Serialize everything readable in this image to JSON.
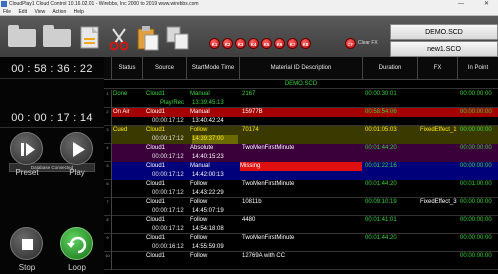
{
  "window": {
    "title": "CloudPlay1 Cloud Control 10.16.02.01 - Wirebbs, Inc 2000 to 2019  www.wirebbs.com",
    "minimize": "—",
    "close": "✕"
  },
  "menu": [
    "File",
    "Edit",
    "View",
    "Action",
    "Help"
  ],
  "toolbar": {
    "icons": [
      "folder-open-icon",
      "folder-icon",
      "save-icon",
      "cut-icon",
      "paste-icon",
      "copy-icon"
    ],
    "keyers": [
      "K1",
      "K2",
      "K3",
      "K4",
      "K5",
      "K6",
      "K7",
      "K8"
    ],
    "clear_fx_button": "CF",
    "clear_fx_label": "Clear FX",
    "scd_primary": "DEMO.SCD",
    "scd_secondary": "new1.SCO"
  },
  "left_panel": {
    "clock": "00 : 58 : 36 : 22",
    "countdown": "00 : 00 : 17 : 14",
    "db_status": "Database Connected",
    "preset_label": "Preset",
    "play_label": "Play",
    "stop_label": "Stop",
    "loop_label": "Loop"
  },
  "grid": {
    "headers": {
      "status": "Status",
      "source": "Source",
      "startmode": "StartMode Time",
      "material": "Material ID Description",
      "duration": "Duration",
      "fx": "FX",
      "inpoint": "In Point"
    },
    "group_title": "DEMO.SCD",
    "rows": [
      {
        "idx": "1",
        "status": "Done",
        "source": "Cloud1",
        "mode": "Manual",
        "material": "2167",
        "duration": "00:00:30:01",
        "fx": "",
        "inpoint": "00:00:00:00",
        "time_col": "",
        "time2": "13:39:45:13",
        "play_rec": "Play/Rec",
        "mat_bg": "",
        "style": "done"
      },
      {
        "idx": "2",
        "status": "On Air",
        "source": "Cloud1",
        "mode": "Manual",
        "material": "15977B",
        "duration": "00:58:54:06",
        "fx": "",
        "inpoint": "00:00:00:00",
        "time_col": "00:00:17:12",
        "time2": "13:40:42:24",
        "play_rec": "",
        "mat_bg": "",
        "style": "onair"
      },
      {
        "idx": "3",
        "status": "Cued",
        "source": "Cloud1",
        "mode": "Follow",
        "material": "70174",
        "duration": "00:01:05:03",
        "fx": "FixedEffect_1",
        "inpoint": "00:00:00:00",
        "time_col": "00:00:17:12",
        "time2": "14:39:37:00",
        "play_rec": "",
        "mat_bg": "",
        "style": "cued"
      },
      {
        "idx": "4",
        "status": "",
        "source": "Cloud1",
        "mode": "Absolute",
        "material": "TwoMenFirstMinute",
        "duration": "00:01:44:20",
        "fx": "",
        "inpoint": "00:00:00:00",
        "time_col": "00:00:17:12",
        "time2": "14:40:15:23",
        "play_rec": "",
        "mat_bg": "",
        "style": "purple"
      },
      {
        "idx": "5",
        "status": "",
        "source": "Cloud1",
        "mode": "Manual",
        "material": "Missing",
        "duration": "00:01:22:16",
        "fx": "",
        "inpoint": "00:00:00:00",
        "time_col": "00:00:17:12",
        "time2": "14:42:00:13",
        "play_rec": "",
        "mat_bg": "red",
        "style": "missing"
      },
      {
        "idx": "6",
        "status": "",
        "source": "Cloud1",
        "mode": "Follow",
        "material": "TwoMenFirstMinute",
        "duration": "00:01:44:20",
        "fx": "",
        "inpoint": "00:01:00:00",
        "time_col": "00:00:17:12",
        "time2": "14:43:22:29",
        "play_rec": "",
        "mat_bg": "",
        "style": "normal"
      },
      {
        "idx": "7",
        "status": "",
        "source": "Cloud1",
        "mode": "Follow",
        "material": "10811b",
        "duration": "00:09:10:19",
        "fx": "FixedEffect_3",
        "inpoint": "00:00:00:00",
        "time_col": "00:00:17:12",
        "time2": "14:45:07:19",
        "play_rec": "",
        "mat_bg": "",
        "style": "normal"
      },
      {
        "idx": "8",
        "status": "",
        "source": "Cloud1",
        "mode": "Follow",
        "material": "4480",
        "duration": "00:01:41:01",
        "fx": "",
        "inpoint": "00:00:00:00",
        "time_col": "00:00:17:12",
        "time2": "14:54:18:08",
        "play_rec": "",
        "mat_bg": "",
        "style": "normal"
      },
      {
        "idx": "9",
        "status": "",
        "source": "Cloud1",
        "mode": "Follow",
        "material": "TwoMenFirstMinute",
        "duration": "00:01:44:20",
        "fx": "",
        "inpoint": "00:00:00:00",
        "time_col": "00:00:16:12",
        "time2": "14:55:59:09",
        "play_rec": "",
        "mat_bg": "",
        "style": "normal"
      },
      {
        "idx": "10",
        "status": "",
        "source": "Cloud1",
        "mode": "Follow",
        "material": "12769A with CC",
        "duration": "",
        "fx": "",
        "inpoint": "00:00:00:00",
        "time_col": "",
        "time2": "",
        "play_rec": "",
        "mat_bg": "",
        "style": "normal"
      }
    ]
  },
  "colors": {
    "done_text": "#3ed43e",
    "on_air_bg": "#a40000",
    "cued_text": "#ffea00",
    "purple_bg": "#3a003a",
    "missing_bg": "#e01010",
    "blue_bg": "#00007a",
    "group_text": "#3ed43e"
  }
}
